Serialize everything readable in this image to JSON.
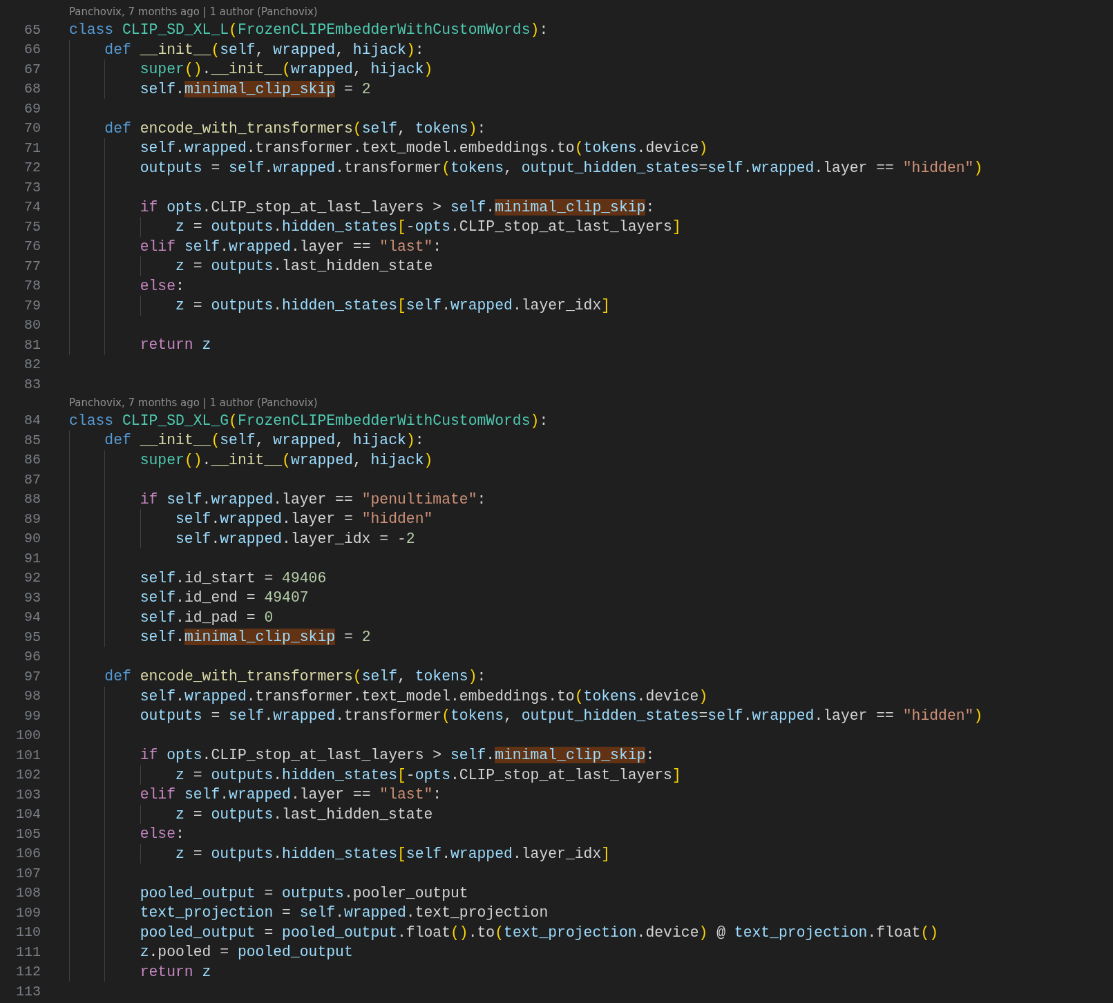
{
  "editor": {
    "blocks": [
      {
        "blame": "Panchovix, 7 months ago | 1 author (Panchovix)",
        "lines": [
          {
            "number": "65",
            "tokens": [
              {
                "kind": "kw",
                "text": "class "
              },
              {
                "kind": "type",
                "text": "CLIP_SD_XL_L"
              },
              {
                "kind": "br",
                "text": "("
              },
              {
                "kind": "type",
                "text": "FrozenCLIPEmbedderWithCustomWords"
              },
              {
                "kind": "br",
                "text": ")"
              },
              {
                "kind": "plain",
                "text": ":"
              }
            ]
          },
          {
            "number": "66",
            "tokens": [
              {
                "kind": "kw",
                "text": "    def "
              },
              {
                "kind": "fn",
                "text": "__init__"
              },
              {
                "kind": "br",
                "text": "("
              },
              {
                "kind": "var",
                "text": "self"
              },
              {
                "kind": "plain",
                "text": ", "
              },
              {
                "kind": "var",
                "text": "wrapped"
              },
              {
                "kind": "plain",
                "text": ", "
              },
              {
                "kind": "var",
                "text": "hijack"
              },
              {
                "kind": "br",
                "text": ")"
              },
              {
                "kind": "plain",
                "text": ":"
              }
            ]
          },
          {
            "number": "67",
            "tokens": [
              {
                "kind": "type",
                "text": "        super"
              },
              {
                "kind": "br",
                "text": "()"
              },
              {
                "kind": "plain",
                "text": "."
              },
              {
                "kind": "fn",
                "text": "__init__"
              },
              {
                "kind": "br",
                "text": "("
              },
              {
                "kind": "var",
                "text": "wrapped"
              },
              {
                "kind": "plain",
                "text": ", "
              },
              {
                "kind": "var",
                "text": "hijack"
              },
              {
                "kind": "br",
                "text": ")"
              }
            ]
          },
          {
            "number": "68",
            "tokens": [
              {
                "kind": "var",
                "text": "        self"
              },
              {
                "kind": "plain",
                "text": "."
              },
              {
                "kind": "hl",
                "text": "minimal_clip_skip"
              },
              {
                "kind": "plain",
                "text": " = "
              },
              {
                "kind": "num",
                "text": "2"
              }
            ]
          },
          {
            "number": "69"
          },
          {
            "number": "70",
            "tokens": [
              {
                "kind": "kw",
                "text": "    def "
              },
              {
                "kind": "fn",
                "text": "encode_with_transformers"
              },
              {
                "kind": "br",
                "text": "("
              },
              {
                "kind": "var",
                "text": "self"
              },
              {
                "kind": "plain",
                "text": ", "
              },
              {
                "kind": "var",
                "text": "tokens"
              },
              {
                "kind": "br",
                "text": ")"
              },
              {
                "kind": "plain",
                "text": ":"
              }
            ]
          },
          {
            "number": "71",
            "tokens": [
              {
                "kind": "var",
                "text": "        self"
              },
              {
                "kind": "plain",
                "text": "."
              },
              {
                "kind": "var",
                "text": "wrapped"
              },
              {
                "kind": "plain",
                "text": ".transformer.text_model.embeddings.to"
              },
              {
                "kind": "br",
                "text": "("
              },
              {
                "kind": "var",
                "text": "tokens"
              },
              {
                "kind": "plain",
                "text": ".device"
              },
              {
                "kind": "br",
                "text": ")"
              }
            ]
          },
          {
            "number": "72",
            "tokens": [
              {
                "kind": "var",
                "text": "        outputs"
              },
              {
                "kind": "plain",
                "text": " = "
              },
              {
                "kind": "var",
                "text": "self"
              },
              {
                "kind": "plain",
                "text": "."
              },
              {
                "kind": "var",
                "text": "wrapped"
              },
              {
                "kind": "plain",
                "text": ".transformer"
              },
              {
                "kind": "br",
                "text": "("
              },
              {
                "kind": "var",
                "text": "tokens"
              },
              {
                "kind": "plain",
                "text": ", "
              },
              {
                "kind": "var",
                "text": "output_hidden_states"
              },
              {
                "kind": "plain",
                "text": "="
              },
              {
                "kind": "var",
                "text": "self"
              },
              {
                "kind": "plain",
                "text": "."
              },
              {
                "kind": "var",
                "text": "wrapped"
              },
              {
                "kind": "plain",
                "text": ".layer == "
              },
              {
                "kind": "str",
                "text": "\"hidden\""
              },
              {
                "kind": "br",
                "text": ")"
              }
            ]
          },
          {
            "number": "73"
          },
          {
            "number": "74",
            "tokens": [
              {
                "kind": "ctl",
                "text": "        if "
              },
              {
                "kind": "var",
                "text": "opts"
              },
              {
                "kind": "plain",
                "text": ".CLIP_stop_at_last_layers > "
              },
              {
                "kind": "var",
                "text": "self"
              },
              {
                "kind": "plain",
                "text": "."
              },
              {
                "kind": "hl",
                "text": "minimal_clip_skip"
              },
              {
                "kind": "plain",
                "text": ":"
              }
            ]
          },
          {
            "number": "75",
            "tokens": [
              {
                "kind": "var",
                "text": "            z"
              },
              {
                "kind": "plain",
                "text": " = "
              },
              {
                "kind": "var",
                "text": "outputs"
              },
              {
                "kind": "plain",
                "text": "."
              },
              {
                "kind": "var",
                "text": "hidden_states"
              },
              {
                "kind": "br",
                "text": "["
              },
              {
                "kind": "plain",
                "text": "-"
              },
              {
                "kind": "var",
                "text": "opts"
              },
              {
                "kind": "plain",
                "text": ".CLIP_stop_at_last_layers"
              },
              {
                "kind": "br",
                "text": "]"
              }
            ]
          },
          {
            "number": "76",
            "tokens": [
              {
                "kind": "ctl",
                "text": "        elif "
              },
              {
                "kind": "var",
                "text": "self"
              },
              {
                "kind": "plain",
                "text": "."
              },
              {
                "kind": "var",
                "text": "wrapped"
              },
              {
                "kind": "plain",
                "text": ".layer == "
              },
              {
                "kind": "str",
                "text": "\"last\""
              },
              {
                "kind": "plain",
                "text": ":"
              }
            ]
          },
          {
            "number": "77",
            "tokens": [
              {
                "kind": "var",
                "text": "            z"
              },
              {
                "kind": "plain",
                "text": " = "
              },
              {
                "kind": "var",
                "text": "outputs"
              },
              {
                "kind": "plain",
                "text": ".last_hidden_state"
              }
            ]
          },
          {
            "number": "78",
            "tokens": [
              {
                "kind": "ctl",
                "text": "        else"
              },
              {
                "kind": "plain",
                "text": ":"
              }
            ]
          },
          {
            "number": "79",
            "tokens": [
              {
                "kind": "var",
                "text": "            z"
              },
              {
                "kind": "plain",
                "text": " = "
              },
              {
                "kind": "var",
                "text": "outputs"
              },
              {
                "kind": "plain",
                "text": "."
              },
              {
                "kind": "var",
                "text": "hidden_states"
              },
              {
                "kind": "br",
                "text": "["
              },
              {
                "kind": "var",
                "text": "self"
              },
              {
                "kind": "plain",
                "text": "."
              },
              {
                "kind": "var",
                "text": "wrapped"
              },
              {
                "kind": "plain",
                "text": ".layer_idx"
              },
              {
                "kind": "br",
                "text": "]"
              }
            ]
          },
          {
            "number": "80"
          },
          {
            "number": "81",
            "tokens": [
              {
                "kind": "ctl",
                "text": "        return "
              },
              {
                "kind": "var",
                "text": "z"
              }
            ]
          },
          {
            "number": "82"
          },
          {
            "number": "83"
          }
        ]
      },
      {
        "blame": "Panchovix, 7 months ago | 1 author (Panchovix)",
        "lines": [
          {
            "number": "84",
            "tokens": [
              {
                "kind": "kw",
                "text": "class "
              },
              {
                "kind": "type",
                "text": "CLIP_SD_XL_G"
              },
              {
                "kind": "br",
                "text": "("
              },
              {
                "kind": "type",
                "text": "FrozenCLIPEmbedderWithCustomWords"
              },
              {
                "kind": "br",
                "text": ")"
              },
              {
                "kind": "plain",
                "text": ":"
              }
            ]
          },
          {
            "number": "85",
            "tokens": [
              {
                "kind": "kw",
                "text": "    def "
              },
              {
                "kind": "fn",
                "text": "__init__"
              },
              {
                "kind": "br",
                "text": "("
              },
              {
                "kind": "var",
                "text": "self"
              },
              {
                "kind": "plain",
                "text": ", "
              },
              {
                "kind": "var",
                "text": "wrapped"
              },
              {
                "kind": "plain",
                "text": ", "
              },
              {
                "kind": "var",
                "text": "hijack"
              },
              {
                "kind": "br",
                "text": ")"
              },
              {
                "kind": "plain",
                "text": ":"
              }
            ]
          },
          {
            "number": "86",
            "tokens": [
              {
                "kind": "type",
                "text": "        super"
              },
              {
                "kind": "br",
                "text": "()"
              },
              {
                "kind": "plain",
                "text": "."
              },
              {
                "kind": "fn",
                "text": "__init__"
              },
              {
                "kind": "br",
                "text": "("
              },
              {
                "kind": "var",
                "text": "wrapped"
              },
              {
                "kind": "plain",
                "text": ", "
              },
              {
                "kind": "var",
                "text": "hijack"
              },
              {
                "kind": "br",
                "text": ")"
              }
            ]
          },
          {
            "number": "87"
          },
          {
            "number": "88",
            "tokens": [
              {
                "kind": "ctl",
                "text": "        if "
              },
              {
                "kind": "var",
                "text": "self"
              },
              {
                "kind": "plain",
                "text": "."
              },
              {
                "kind": "var",
                "text": "wrapped"
              },
              {
                "kind": "plain",
                "text": ".layer == "
              },
              {
                "kind": "str",
                "text": "\"penultimate\""
              },
              {
                "kind": "plain",
                "text": ":"
              }
            ]
          },
          {
            "number": "89",
            "tokens": [
              {
                "kind": "var",
                "text": "            self"
              },
              {
                "kind": "plain",
                "text": "."
              },
              {
                "kind": "var",
                "text": "wrapped"
              },
              {
                "kind": "plain",
                "text": ".layer = "
              },
              {
                "kind": "str",
                "text": "\"hidden\""
              }
            ]
          },
          {
            "number": "90",
            "tokens": [
              {
                "kind": "var",
                "text": "            self"
              },
              {
                "kind": "plain",
                "text": "."
              },
              {
                "kind": "var",
                "text": "wrapped"
              },
              {
                "kind": "plain",
                "text": ".layer_idx = -"
              },
              {
                "kind": "num",
                "text": "2"
              }
            ]
          },
          {
            "number": "91"
          },
          {
            "number": "92",
            "tokens": [
              {
                "kind": "var",
                "text": "        self"
              },
              {
                "kind": "plain",
                "text": ".id_start = "
              },
              {
                "kind": "num",
                "text": "49406"
              }
            ]
          },
          {
            "number": "93",
            "tokens": [
              {
                "kind": "var",
                "text": "        self"
              },
              {
                "kind": "plain",
                "text": ".id_end = "
              },
              {
                "kind": "num",
                "text": "49407"
              }
            ]
          },
          {
            "number": "94",
            "tokens": [
              {
                "kind": "var",
                "text": "        self"
              },
              {
                "kind": "plain",
                "text": ".id_pad = "
              },
              {
                "kind": "num",
                "text": "0"
              }
            ]
          },
          {
            "number": "95",
            "tokens": [
              {
                "kind": "var",
                "text": "        self"
              },
              {
                "kind": "plain",
                "text": "."
              },
              {
                "kind": "hl",
                "text": "minimal_clip_skip"
              },
              {
                "kind": "plain",
                "text": " = "
              },
              {
                "kind": "num",
                "text": "2"
              }
            ]
          },
          {
            "number": "96"
          },
          {
            "number": "97",
            "tokens": [
              {
                "kind": "kw",
                "text": "    def "
              },
              {
                "kind": "fn",
                "text": "encode_with_transformers"
              },
              {
                "kind": "br",
                "text": "("
              },
              {
                "kind": "var",
                "text": "self"
              },
              {
                "kind": "plain",
                "text": ", "
              },
              {
                "kind": "var",
                "text": "tokens"
              },
              {
                "kind": "br",
                "text": ")"
              },
              {
                "kind": "plain",
                "text": ":"
              }
            ]
          },
          {
            "number": "98",
            "tokens": [
              {
                "kind": "var",
                "text": "        self"
              },
              {
                "kind": "plain",
                "text": "."
              },
              {
                "kind": "var",
                "text": "wrapped"
              },
              {
                "kind": "plain",
                "text": ".transformer.text_model.embeddings.to"
              },
              {
                "kind": "br",
                "text": "("
              },
              {
                "kind": "var",
                "text": "tokens"
              },
              {
                "kind": "plain",
                "text": ".device"
              },
              {
                "kind": "br",
                "text": ")"
              }
            ]
          },
          {
            "number": "99",
            "tokens": [
              {
                "kind": "var",
                "text": "        outputs"
              },
              {
                "kind": "plain",
                "text": " = "
              },
              {
                "kind": "var",
                "text": "self"
              },
              {
                "kind": "plain",
                "text": "."
              },
              {
                "kind": "var",
                "text": "wrapped"
              },
              {
                "kind": "plain",
                "text": ".transformer"
              },
              {
                "kind": "br",
                "text": "("
              },
              {
                "kind": "var",
                "text": "tokens"
              },
              {
                "kind": "plain",
                "text": ", "
              },
              {
                "kind": "var",
                "text": "output_hidden_states"
              },
              {
                "kind": "plain",
                "text": "="
              },
              {
                "kind": "var",
                "text": "self"
              },
              {
                "kind": "plain",
                "text": "."
              },
              {
                "kind": "var",
                "text": "wrapped"
              },
              {
                "kind": "plain",
                "text": ".layer == "
              },
              {
                "kind": "str",
                "text": "\"hidden\""
              },
              {
                "kind": "br",
                "text": ")"
              }
            ]
          },
          {
            "number": "100"
          },
          {
            "number": "101",
            "tokens": [
              {
                "kind": "ctl",
                "text": "        if "
              },
              {
                "kind": "var",
                "text": "opts"
              },
              {
                "kind": "plain",
                "text": ".CLIP_stop_at_last_layers > "
              },
              {
                "kind": "var",
                "text": "self"
              },
              {
                "kind": "plain",
                "text": "."
              },
              {
                "kind": "hl",
                "text": "minimal_clip_skip"
              },
              {
                "kind": "plain",
                "text": ":"
              }
            ]
          },
          {
            "number": "102",
            "tokens": [
              {
                "kind": "var",
                "text": "            z"
              },
              {
                "kind": "plain",
                "text": " = "
              },
              {
                "kind": "var",
                "text": "outputs"
              },
              {
                "kind": "plain",
                "text": "."
              },
              {
                "kind": "var",
                "text": "hidden_states"
              },
              {
                "kind": "br",
                "text": "["
              },
              {
                "kind": "plain",
                "text": "-"
              },
              {
                "kind": "var",
                "text": "opts"
              },
              {
                "kind": "plain",
                "text": ".CLIP_stop_at_last_layers"
              },
              {
                "kind": "br",
                "text": "]"
              }
            ]
          },
          {
            "number": "103",
            "tokens": [
              {
                "kind": "ctl",
                "text": "        elif "
              },
              {
                "kind": "var",
                "text": "self"
              },
              {
                "kind": "plain",
                "text": "."
              },
              {
                "kind": "var",
                "text": "wrapped"
              },
              {
                "kind": "plain",
                "text": ".layer == "
              },
              {
                "kind": "str",
                "text": "\"last\""
              },
              {
                "kind": "plain",
                "text": ":"
              }
            ]
          },
          {
            "number": "104",
            "tokens": [
              {
                "kind": "var",
                "text": "            z"
              },
              {
                "kind": "plain",
                "text": " = "
              },
              {
                "kind": "var",
                "text": "outputs"
              },
              {
                "kind": "plain",
                "text": ".last_hidden_state"
              }
            ]
          },
          {
            "number": "105",
            "tokens": [
              {
                "kind": "ctl",
                "text": "        else"
              },
              {
                "kind": "plain",
                "text": ":"
              }
            ]
          },
          {
            "number": "106",
            "tokens": [
              {
                "kind": "var",
                "text": "            z"
              },
              {
                "kind": "plain",
                "text": " = "
              },
              {
                "kind": "var",
                "text": "outputs"
              },
              {
                "kind": "plain",
                "text": "."
              },
              {
                "kind": "var",
                "text": "hidden_states"
              },
              {
                "kind": "br",
                "text": "["
              },
              {
                "kind": "var",
                "text": "self"
              },
              {
                "kind": "plain",
                "text": "."
              },
              {
                "kind": "var",
                "text": "wrapped"
              },
              {
                "kind": "plain",
                "text": ".layer_idx"
              },
              {
                "kind": "br",
                "text": "]"
              }
            ]
          },
          {
            "number": "107"
          },
          {
            "number": "108",
            "tokens": [
              {
                "kind": "var",
                "text": "        pooled_output"
              },
              {
                "kind": "plain",
                "text": " = "
              },
              {
                "kind": "var",
                "text": "outputs"
              },
              {
                "kind": "plain",
                "text": ".pooler_output"
              }
            ]
          },
          {
            "number": "109",
            "tokens": [
              {
                "kind": "var",
                "text": "        text_projection"
              },
              {
                "kind": "plain",
                "text": " = "
              },
              {
                "kind": "var",
                "text": "self"
              },
              {
                "kind": "plain",
                "text": "."
              },
              {
                "kind": "var",
                "text": "wrapped"
              },
              {
                "kind": "plain",
                "text": ".text_projection"
              }
            ]
          },
          {
            "number": "110",
            "tokens": [
              {
                "kind": "var",
                "text": "        pooled_output"
              },
              {
                "kind": "plain",
                "text": " = "
              },
              {
                "kind": "var",
                "text": "pooled_output"
              },
              {
                "kind": "plain",
                "text": ".float"
              },
              {
                "kind": "br",
                "text": "()"
              },
              {
                "kind": "plain",
                "text": ".to"
              },
              {
                "kind": "br",
                "text": "("
              },
              {
                "kind": "var",
                "text": "text_projection"
              },
              {
                "kind": "plain",
                "text": ".device"
              },
              {
                "kind": "br",
                "text": ")"
              },
              {
                "kind": "plain",
                "text": " @ "
              },
              {
                "kind": "var",
                "text": "text_projection"
              },
              {
                "kind": "plain",
                "text": ".float"
              },
              {
                "kind": "br",
                "text": "()"
              }
            ]
          },
          {
            "number": "111",
            "tokens": [
              {
                "kind": "var",
                "text": "        z"
              },
              {
                "kind": "plain",
                "text": ".pooled = "
              },
              {
                "kind": "var",
                "text": "pooled_output"
              }
            ]
          },
          {
            "number": "112",
            "tokens": [
              {
                "kind": "ctl",
                "text": "        return "
              },
              {
                "kind": "var",
                "text": "z"
              }
            ]
          },
          {
            "number": "113"
          }
        ]
      }
    ]
  }
}
